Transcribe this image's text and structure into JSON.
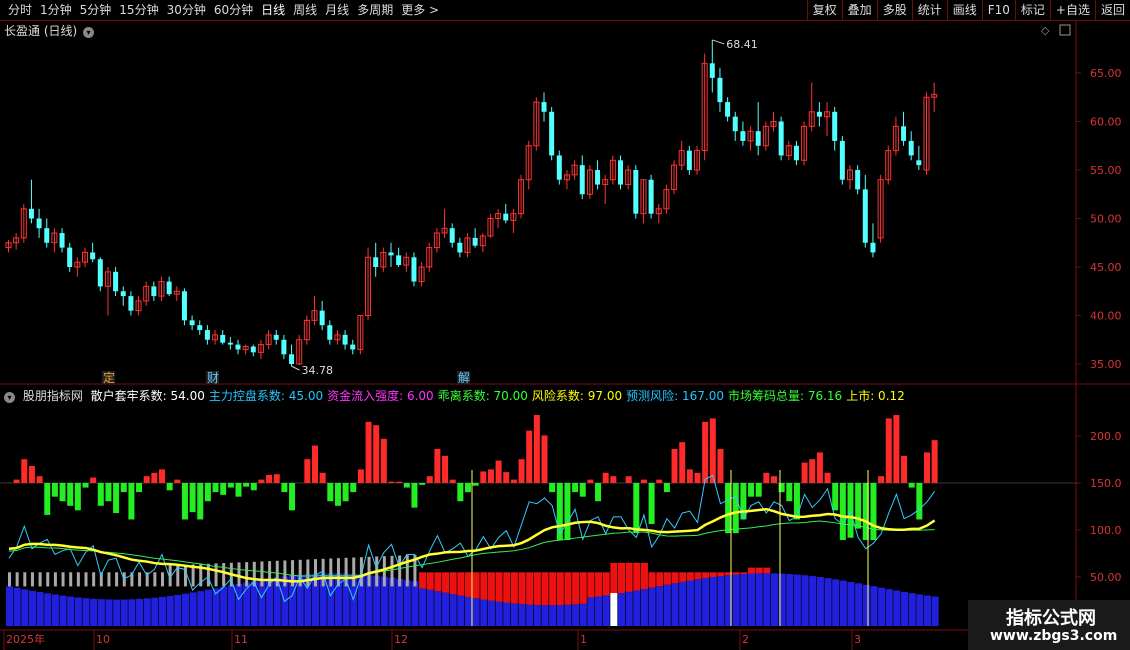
{
  "toolbar": {
    "periods": [
      "分时",
      "1分钟",
      "5分钟",
      "15分钟",
      "30分钟",
      "60分钟",
      "日线",
      "周线",
      "月线",
      "多周期",
      "更多 >"
    ],
    "active": "日线",
    "actions": [
      "复权",
      "叠加",
      "多股",
      "统计",
      "画线",
      "F10",
      "标记",
      "+自选",
      "返回"
    ]
  },
  "stock": {
    "title": "长盈通 (日线)"
  },
  "price_axis": [
    "65.00",
    "60.00",
    "55.00",
    "50.00",
    "45.00",
    "40.00",
    "35.00"
  ],
  "price_high": "68.41",
  "price_low": "34.78",
  "event_marks": [
    "定",
    "财",
    "解"
  ],
  "indicator": {
    "name": "股朋指标网",
    "items": [
      {
        "label": "散户套牢系数: 54.00",
        "color": "#ffffff"
      },
      {
        "label": "主力控盘系数: 45.00",
        "color": "#22c7ff"
      },
      {
        "label": "资金流入强度: 6.00",
        "color": "#ff33ff"
      },
      {
        "label": "乖离系数: 70.00",
        "color": "#33ff33"
      },
      {
        "label": "风险系数: 97.00",
        "color": "#ffff00"
      },
      {
        "label": "预测风险: 167.00",
        "color": "#22c7ff"
      },
      {
        "label": "市场筹码总量: 76.16",
        "color": "#33ff33"
      },
      {
        "label": "上市: 0.12",
        "color": "#ffff00"
      }
    ],
    "axis": [
      "200.0",
      "150.0",
      "100.0",
      "50.00"
    ]
  },
  "date_axis": [
    "2025年",
    "10",
    "11",
    "12",
    "1",
    "2",
    "3"
  ],
  "watermark": {
    "main": "指标公式网",
    "sub": "www.zbgs3.com"
  },
  "colors": {
    "up": "#ff3333",
    "down": "#54ffff",
    "grid": "#7a0e0e"
  },
  "chart_data": {
    "type": "candlestick",
    "ylim": [
      34,
      70
    ],
    "candles": [
      [
        47.0,
        47.8,
        46.5,
        47.5
      ],
      [
        47.5,
        48.5,
        46.8,
        48.0
      ],
      [
        48,
        51.5,
        47.5,
        51
      ],
      [
        51,
        54,
        49.5,
        50
      ],
      [
        50,
        51,
        48,
        49
      ],
      [
        49,
        50,
        47,
        47.5
      ],
      [
        47.5,
        49,
        46.5,
        48.5
      ],
      [
        48.5,
        49,
        46.5,
        47
      ],
      [
        47,
        47.5,
        44.5,
        45
      ],
      [
        45,
        46,
        44,
        45.5
      ],
      [
        45.5,
        47,
        45,
        46.5
      ],
      [
        46.5,
        47.5,
        45.5,
        45.8
      ],
      [
        45.8,
        46,
        42.5,
        43
      ],
      [
        43,
        45,
        40,
        44.5
      ],
      [
        44.5,
        45,
        42,
        42.5
      ],
      [
        42.5,
        43,
        41,
        42
      ],
      [
        42,
        42.5,
        40,
        40.5
      ],
      [
        40.5,
        42,
        40,
        41.5
      ],
      [
        41.5,
        43.5,
        41,
        43
      ],
      [
        43,
        43.5,
        41.5,
        42
      ],
      [
        42,
        44,
        41.5,
        43.5
      ],
      [
        43.5,
        44,
        42,
        42.2
      ],
      [
        42.2,
        43,
        41.5,
        42.5
      ],
      [
        42.5,
        42.8,
        39,
        39.5
      ],
      [
        39.5,
        40,
        38.5,
        39
      ],
      [
        39,
        39.5,
        38,
        38.5
      ],
      [
        38.5,
        39,
        37,
        37.5
      ],
      [
        37.5,
        38.5,
        37,
        38
      ],
      [
        38,
        38.5,
        37,
        37.2
      ],
      [
        37.2,
        37.8,
        36.5,
        37
      ],
      [
        37,
        37.5,
        36,
        36.5
      ],
      [
        36.5,
        37,
        36,
        36.8
      ],
      [
        36.8,
        37,
        35.8,
        36.2
      ],
      [
        36.2,
        37.5,
        35.5,
        37
      ],
      [
        37,
        38.5,
        36.5,
        38
      ],
      [
        38,
        38.5,
        37,
        37.5
      ],
      [
        37.5,
        38,
        35.5,
        36
      ],
      [
        36,
        37,
        34.78,
        35
      ],
      [
        35,
        38,
        34.9,
        37.5
      ],
      [
        37.5,
        40,
        37,
        39.5
      ],
      [
        39.5,
        42,
        39,
        40.5
      ],
      [
        40.5,
        41.5,
        38.5,
        39
      ],
      [
        39,
        39.5,
        37,
        37.5
      ],
      [
        37.5,
        38.5,
        37,
        38
      ],
      [
        38,
        38.5,
        36.5,
        37
      ],
      [
        37,
        37.5,
        36,
        36.5
      ],
      [
        36.5,
        40,
        36,
        40
      ],
      [
        40,
        47,
        39.5,
        46
      ],
      [
        46,
        47.5,
        44,
        45
      ],
      [
        45,
        47,
        44.5,
        46.5
      ],
      [
        46.5,
        47.5,
        45,
        46.2
      ],
      [
        46.2,
        47,
        45,
        45.2
      ],
      [
        45.2,
        46.5,
        44.5,
        46
      ],
      [
        46,
        46.5,
        43,
        43.5
      ],
      [
        43.5,
        45.5,
        43,
        45
      ],
      [
        45,
        47.5,
        44.5,
        47
      ],
      [
        47,
        49,
        46.5,
        48.5
      ],
      [
        48.5,
        51,
        48,
        49
      ],
      [
        49,
        49.5,
        47,
        47.5
      ],
      [
        47.5,
        48,
        46,
        46.5
      ],
      [
        46.5,
        48.5,
        46,
        48
      ],
      [
        48,
        49,
        47,
        47.2
      ],
      [
        47.2,
        48.5,
        46.5,
        48.2
      ],
      [
        48.2,
        50.5,
        48,
        50
      ],
      [
        50,
        51,
        49,
        50.5
      ],
      [
        50.5,
        51.5,
        49.5,
        49.8
      ],
      [
        49.8,
        51,
        48.5,
        50.5
      ],
      [
        50.5,
        54.5,
        50,
        54
      ],
      [
        54,
        58,
        53,
        57.5
      ],
      [
        57.5,
        62.5,
        57,
        62
      ],
      [
        62,
        63,
        60,
        61
      ],
      [
        61,
        61.5,
        56,
        56.5
      ],
      [
        56.5,
        57,
        53.5,
        54
      ],
      [
        54,
        55,
        53,
        54.5
      ],
      [
        54.5,
        56,
        54,
        55.5
      ],
      [
        55.5,
        56.5,
        52,
        52.5
      ],
      [
        52.5,
        55.5,
        52,
        55
      ],
      [
        55,
        56,
        53,
        53.5
      ],
      [
        53.5,
        54.5,
        51.5,
        54
      ],
      [
        54,
        56.5,
        53.5,
        56
      ],
      [
        56,
        56.5,
        53,
        53.5
      ],
      [
        53.5,
        55.5,
        53,
        55
      ],
      [
        55,
        55.5,
        50,
        50.5
      ],
      [
        50.5,
        54,
        49.5,
        54
      ],
      [
        54,
        54.5,
        50,
        50.5
      ],
      [
        50.5,
        51.5,
        49.5,
        51
      ],
      [
        51,
        53.5,
        50.5,
        53
      ],
      [
        53,
        56,
        52.5,
        55.5
      ],
      [
        55.5,
        58,
        55,
        57
      ],
      [
        57,
        57.5,
        54.5,
        55
      ],
      [
        55,
        57.5,
        54.5,
        57
      ],
      [
        57,
        67,
        56,
        66
      ],
      [
        66,
        68.41,
        63,
        64.5
      ],
      [
        64.5,
        65.5,
        61,
        62
      ],
      [
        62,
        62.5,
        60,
        60.5
      ],
      [
        60.5,
        61,
        58,
        59
      ],
      [
        59,
        60,
        57.5,
        58
      ],
      [
        58,
        59.5,
        57,
        59
      ],
      [
        59,
        62,
        56.5,
        57.5
      ],
      [
        57.5,
        60,
        57,
        59.5
      ],
      [
        59.5,
        61,
        59,
        60
      ],
      [
        60,
        60.5,
        56,
        56.5
      ],
      [
        56.5,
        58,
        56,
        57.5
      ],
      [
        57.5,
        58,
        55.5,
        56
      ],
      [
        56,
        60,
        55.5,
        59.5
      ],
      [
        59.5,
        64,
        59,
        61
      ],
      [
        61,
        62,
        59.5,
        60.5
      ],
      [
        60.5,
        62,
        58.5,
        61
      ],
      [
        61,
        61.5,
        57,
        58
      ],
      [
        58,
        58.5,
        53.5,
        54
      ],
      [
        54,
        55.5,
        53,
        55
      ],
      [
        55,
        55.5,
        52.5,
        53
      ],
      [
        53,
        54.5,
        47,
        47.5
      ],
      [
        47.5,
        49.5,
        46,
        46.5
      ],
      [
        48,
        54.5,
        47.5,
        54
      ],
      [
        54,
        57.5,
        53.5,
        57
      ],
      [
        57,
        60.5,
        56.5,
        59.5
      ],
      [
        59.5,
        61,
        57.5,
        58
      ],
      [
        58,
        59,
        56,
        56.5
      ],
      [
        56,
        57.5,
        55,
        55.5
      ],
      [
        55,
        63,
        54.5,
        62.5
      ],
      [
        62.5,
        64,
        61,
        62.8
      ]
    ]
  }
}
